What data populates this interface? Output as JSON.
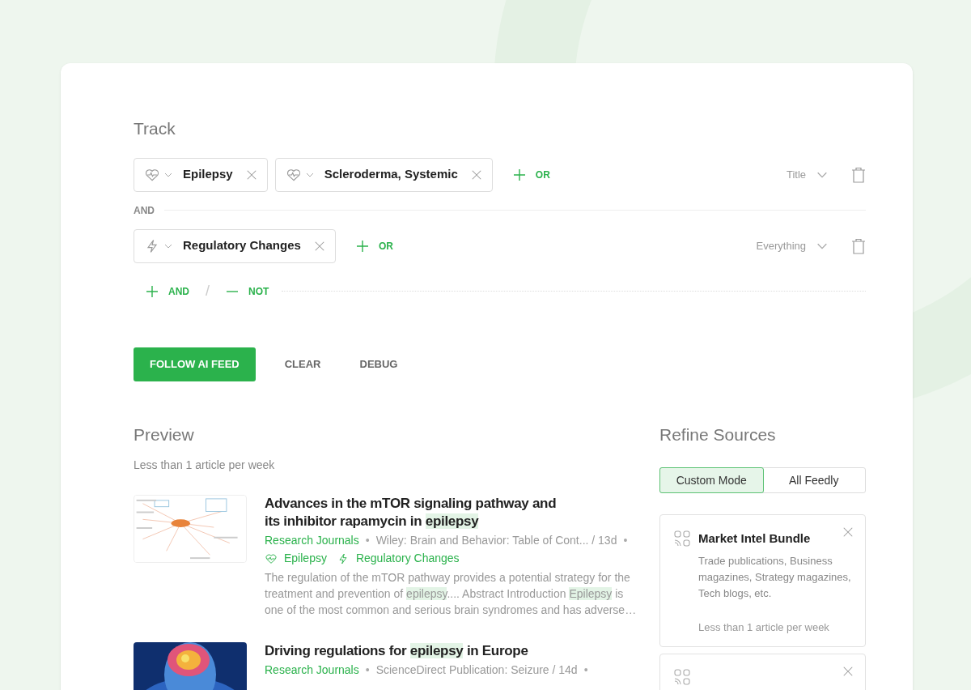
{
  "heading": "Track",
  "groups": [
    {
      "chips": [
        {
          "kind": "topic",
          "label": "Epilepsy"
        },
        {
          "kind": "topic",
          "label": "Scleroderma, Systemic"
        }
      ],
      "or_label": "OR",
      "scope": "Title"
    },
    {
      "chips": [
        {
          "kind": "trend",
          "label": "Regulatory Changes"
        }
      ],
      "or_label": "OR",
      "scope": "Everything"
    }
  ],
  "joiner": "AND",
  "add_and": "AND",
  "add_not": "NOT",
  "slash": "/",
  "buttons": [
    {
      "label": "FOLLOW AI FEED",
      "kind": "primary"
    },
    {
      "label": "CLEAR",
      "kind": "text"
    },
    {
      "label": "DEBUG",
      "kind": "text"
    }
  ],
  "preview": {
    "title": "Preview",
    "rate": "Less than 1 article per week",
    "articles": [
      {
        "title": [
          {
            "text": "Advances in the mTOR signaling pathway and its inhibitor rapamycin in ",
            "highlight": false
          },
          {
            "text": "epilepsy",
            "highlight": true
          }
        ],
        "source": "Research Journals",
        "separator": "•",
        "meta": "Wiley: Brain and Behavior: Table of Cont... / 13d",
        "trailing": "•",
        "tags": [
          {
            "kind": "topic",
            "label": "Epilepsy"
          },
          {
            "kind": "trend",
            "label": "Regulatory Changes"
          }
        ],
        "summary": [
          {
            "text": "The regulation of the mTOR pathway provides a potential strategy for the treatment and prevention of ",
            "highlight": false
          },
          {
            "text": "epilepsy",
            "highlight": true
          },
          {
            "text": ".... Abstract Introduction ",
            "highlight": false
          },
          {
            "text": "Epilepsy",
            "highlight": true
          },
          {
            "text": " is one of the most common and serious brain syndromes and has adverse…",
            "highlight": false
          }
        ]
      },
      {
        "title": [
          {
            "text": "Driving regulations for ",
            "highlight": false
          },
          {
            "text": "epilepsy",
            "highlight": true
          },
          {
            "text": " in Europe",
            "highlight": false
          }
        ],
        "source": "Research Journals",
        "separator": "•",
        "meta": "ScienceDirect Publication: Seizure / 14d",
        "trailing": "•"
      }
    ]
  },
  "refine": {
    "title": "Refine Sources",
    "modes": [
      {
        "label": "Custom Mode",
        "selected": true
      },
      {
        "label": "All Feedly",
        "selected": false
      }
    ],
    "bundles": [
      {
        "kind": "bundle",
        "name": "Market Intel Bundle",
        "description": "Trade publications, Business magazines, Strategy magazines, Tech blogs, etc.",
        "rate": "Less than 1 article per week"
      },
      {
        "kind": "bundle"
      }
    ]
  }
}
